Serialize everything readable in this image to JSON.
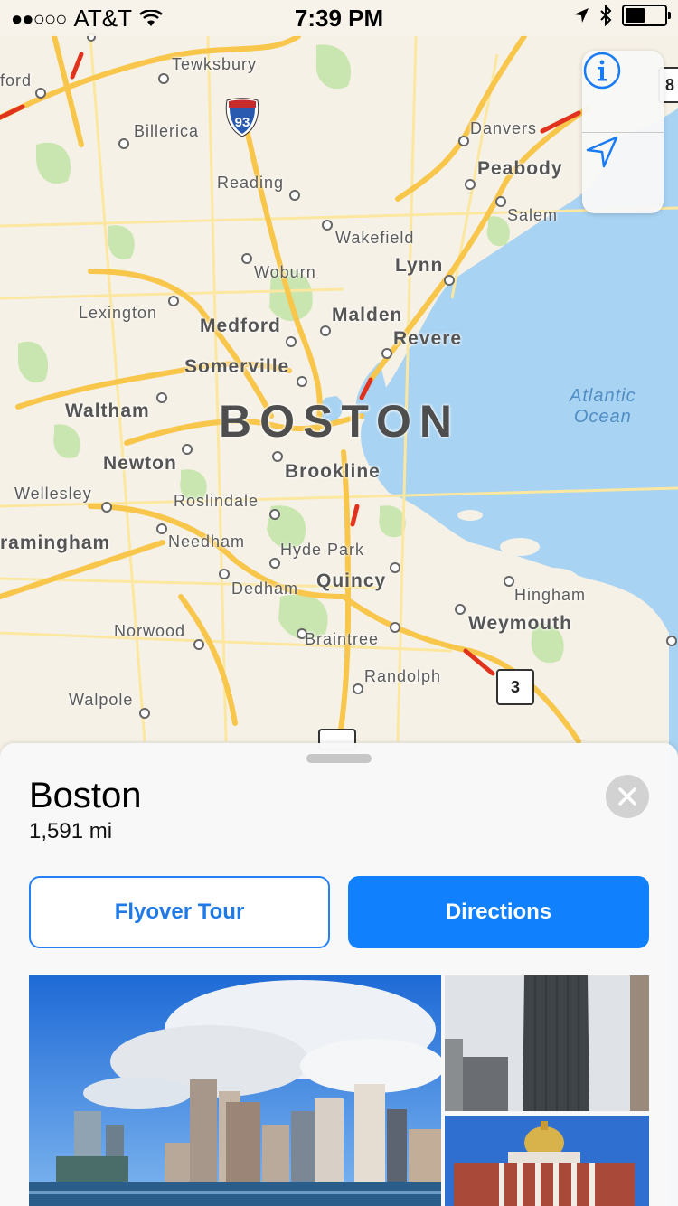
{
  "status_bar": {
    "signal": "●●○○○",
    "carrier": "AT&T",
    "time": "7:39 PM",
    "battery_level": 0.45,
    "icons": [
      "wifi-icon",
      "location-arrow-icon",
      "bluetooth-icon",
      "battery-icon"
    ]
  },
  "map": {
    "city_label": "BOSTON",
    "water_label_1": "Atlantic",
    "water_label_2": "Ocean",
    "highway_shield": "93",
    "route_sign": "3",
    "edge_route": "8",
    "places": {
      "tewksbury": "Tewksbury",
      "ford": "ford",
      "billerica": "Billerica",
      "danvers": "Danvers",
      "peabody": "Peabody",
      "salem": "Salem",
      "reading": "Reading",
      "wakefield": "Wakefield",
      "lynn": "Lynn",
      "woburn": "Woburn",
      "lexington": "Lexington",
      "medford": "Medford",
      "malden": "Malden",
      "revere": "Revere",
      "somerville": "Somerville",
      "waltham": "Waltham",
      "newton": "Newton",
      "brookline": "Brookline",
      "wellesley": "Wellesley",
      "roslindale": "Roslindale",
      "framingham": "ramingham",
      "needham": "Needham",
      "hyde_park": "Hyde Park",
      "quincy": "Quincy",
      "hingham": "Hingham",
      "dedham": "Dedham",
      "weymouth": "Weymouth",
      "norwood": "Norwood",
      "braintree": "Braintree",
      "randolph": "Randolph",
      "walpole": "Walpole"
    },
    "controls": {
      "info_icon": "info-icon",
      "location_icon": "location-arrow-icon"
    }
  },
  "sheet": {
    "title": "Boston",
    "distance": "1,591 mi",
    "flyover_label": "Flyover Tour",
    "directions_label": "Directions",
    "photos": [
      "boston-skyline-photo",
      "prudential-tower-photo",
      "state-house-photo"
    ]
  },
  "colors": {
    "accent": "#1080fc",
    "water": "#a9d3f2",
    "land": "#f6f1e6",
    "park": "#c9e6b0",
    "road_major": "#f7c64b",
    "road_minor": "#fbe7a0",
    "traffic": "#e0321c"
  }
}
